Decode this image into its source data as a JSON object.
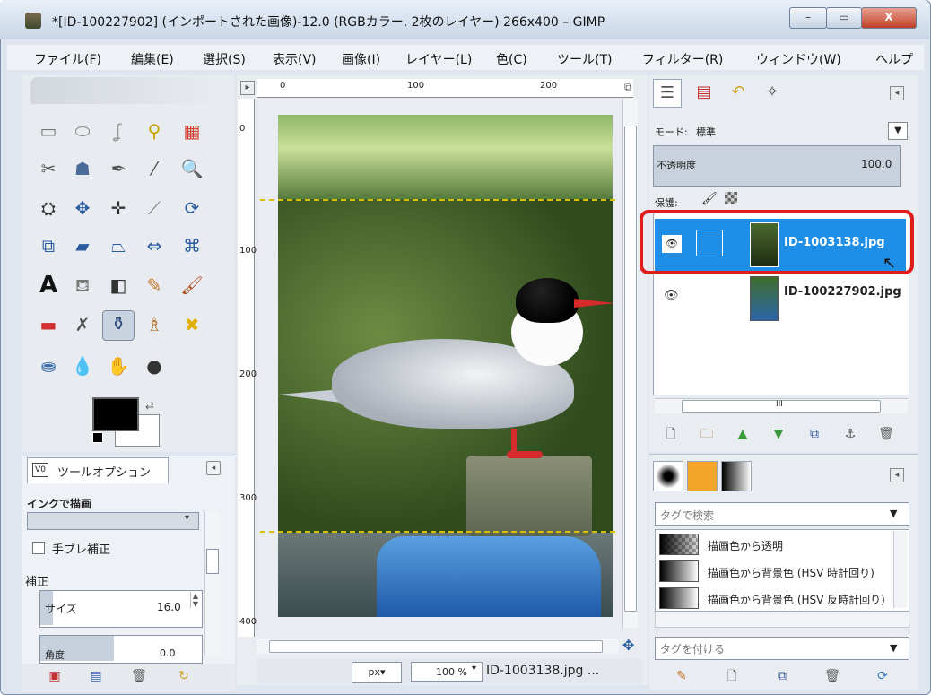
{
  "window": {
    "title": "*[ID-100227902] (インポートされた画像)-12.0 (RGBカラー, 2枚のレイヤー) 266x400 – GIMP",
    "minimize": "–",
    "maximize": "▭",
    "close": "X"
  },
  "menubar": [
    "ファイル(F)",
    "編集(E)",
    "選択(S)",
    "表示(V)",
    "画像(I)",
    "レイヤー(L)",
    "色(C)",
    "ツール(T)",
    "フィルター(R)",
    "ウィンドウ(W)",
    "ヘルプ"
  ],
  "ruler": {
    "h_ticks": [
      "0",
      "100",
      "200"
    ],
    "v_ticks": [
      "0",
      "100",
      "200",
      "300",
      "400"
    ]
  },
  "tool_options": {
    "tab_label": "ツールオプション",
    "tab_icon": "V0",
    "tool_title": "インクで描画",
    "stabilize_label": "手ブレ補正",
    "correction_label": "補正",
    "size_label": "サイズ",
    "size_value": "16.0",
    "angle_label": "角度",
    "angle_value": "0.0"
  },
  "statusbar": {
    "unit": "px▾",
    "zoom": "100 %",
    "message": "ID-1003138.jpg ..."
  },
  "layers": {
    "mode_label": "モード:",
    "mode_value": "標準",
    "opacity_label": "不透明度",
    "opacity_value": "100.0",
    "protect_label": "保護:",
    "items": [
      {
        "name": "ID-1003138.jpg",
        "selected": true
      },
      {
        "name": "ID-100227902.jpg",
        "selected": false
      }
    ],
    "scroll_label": "III"
  },
  "gradients": {
    "search_placeholder": "タグで検索",
    "tag_placeholder": "タグを付ける",
    "items": [
      "描画色から透明",
      "描画色から背景色 (HSV 時計回り)",
      "描画色から背景色 (HSV 反時計回り)"
    ]
  },
  "colors": {
    "selection": "#1e8ee6",
    "highlight_outline": "#e01c1c",
    "foreground": "#000000",
    "background": "#ffffff"
  }
}
